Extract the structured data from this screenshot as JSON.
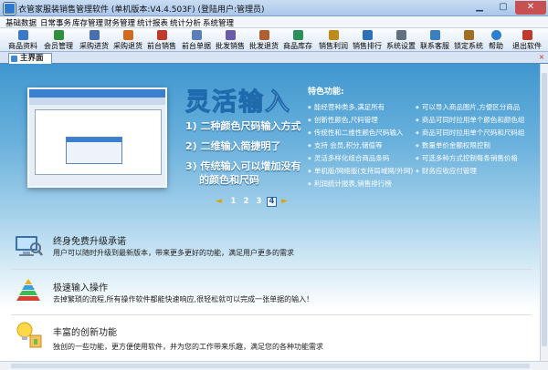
{
  "window": {
    "title": "衣管家服装销售管理软件 (单机版本:V4.4.503F) (登陆用户:管理员)",
    "minimize_icon": "minimize-icon",
    "maximize_icon": "maximize-icon",
    "close_icon": "close-icon"
  },
  "menu": [
    "基础数据",
    "日常事务",
    "库存管理",
    "财务管理",
    "统计报表",
    "统计分析",
    "系统管理"
  ],
  "toolbar": [
    {
      "label": "商品资料",
      "icon": "product-icon",
      "color": "#3a78c8"
    },
    {
      "label": "会员管理",
      "icon": "member-icon",
      "color": "#2f8f3a"
    },
    {
      "label": "采购进货",
      "icon": "purchase-icon",
      "color": "#4a6fb0"
    },
    {
      "label": "采购退货",
      "icon": "purchase-return-icon",
      "color": "#d06a1c"
    },
    {
      "label": "前台销售",
      "icon": "pos-sale-icon",
      "color": "#c0392b"
    },
    {
      "label": "前台单据",
      "icon": "pos-receipt-icon",
      "color": "#5a7fb8"
    },
    {
      "label": "批发销售",
      "icon": "wholesale-icon",
      "color": "#6a5aa8"
    },
    {
      "label": "批发退货",
      "icon": "wholesale-return-icon",
      "color": "#b06030"
    },
    {
      "label": "商品库存",
      "icon": "inventory-icon",
      "color": "#2b8f5a"
    },
    {
      "label": "销售利润",
      "icon": "profit-icon",
      "color": "#c08a1a"
    },
    {
      "label": "销售排行",
      "icon": "ranking-icon",
      "color": "#2d6fb8"
    },
    {
      "label": "系统设置",
      "icon": "settings-icon",
      "color": "#607080"
    },
    {
      "label": "联系客服",
      "icon": "support-icon",
      "color": "#3a7fc0"
    },
    {
      "label": "锁定系统",
      "icon": "lock-icon",
      "color": "#a07020"
    },
    {
      "label": "帮助",
      "icon": "help-icon",
      "color": "#2f7fcf"
    },
    {
      "label": "退出软件",
      "icon": "exit-icon",
      "color": "#c0392b"
    }
  ],
  "tab": {
    "label": "主界面",
    "close": "×"
  },
  "banner": {
    "title": "灵活输入",
    "steps": [
      "1) 二种颜色尺码输入方式",
      "2) 二维输入简捷明了",
      "3) 传统输入可以增加没有",
      "的颜色和尺码"
    ],
    "features_title": "特色功能:",
    "features_left": [
      "能经营种类多,满足所有",
      "创新性颜色,尺码管理",
      "传统性和二维性颜色尺码输入",
      "支持 会员,积分,储值等",
      "灵活多样化组合商品条码",
      "单机版/网络版(支持局域网/外网)",
      "利润统计报表,销售排行榜"
    ],
    "features_right": [
      "可以导入商品图片,方便区分商品",
      "商品可同时拉用单个颜色和颜色组",
      "商品可同时拉用单个尺码和尺码组",
      "数量单价金额权限控制",
      "可选多种方式控制每条销售价格",
      "财务应收应付管理"
    ],
    "pagination": {
      "prev": "◄",
      "pages": [
        "1",
        "2",
        "3",
        "4"
      ],
      "active": "4",
      "next": "►"
    }
  },
  "info": [
    {
      "title": "终身免费升级承诺",
      "desc": "用户可以随时升级到最新版本，带来更多更好的功能，满足用户更多的需求",
      "icon": "computer-upgrade-icon"
    },
    {
      "title": "极速输入操作",
      "desc": "去掉繁琐的流程,所有操作软件都能快速响应,很轻松就可以完成一张单据的输入！",
      "icon": "pyramid-icon"
    },
    {
      "title": "丰富的创新功能",
      "desc": "独创的一些功能，更方便使用软件，并为您的工作带来乐趣，满足您的各种功能需求",
      "icon": "lightbulb-icon"
    }
  ]
}
